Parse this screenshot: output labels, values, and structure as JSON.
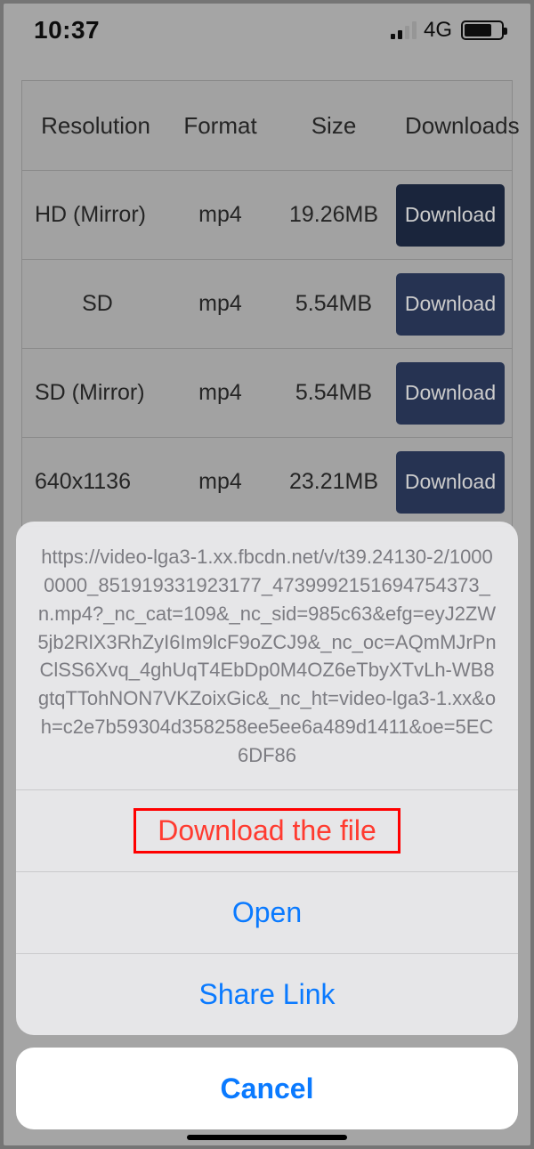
{
  "status": {
    "time": "10:37",
    "network": "4G"
  },
  "table": {
    "headers": {
      "resolution": "Resolution",
      "format": "Format",
      "size": "Size",
      "downloads": "Downloads"
    },
    "download_label": "Download",
    "rows": [
      {
        "resolution": "HD (Mirror)",
        "format": "mp4",
        "size": "19.26MB"
      },
      {
        "resolution": "SD",
        "format": "mp4",
        "size": "5.54MB"
      },
      {
        "resolution": "SD (Mirror)",
        "format": "mp4",
        "size": "5.54MB"
      },
      {
        "resolution": "640x1136",
        "format": "mp4",
        "size": "23.21MB"
      }
    ]
  },
  "sheet": {
    "message": "https://video-lga3-1.xx.fbcdn.net/v/t39.24130-2/10000000_851919331923177_4739992151694754373_n.mp4?_nc_cat=109&_nc_sid=985c63&efg=eyJ2ZW5jb2RlX3RhZyI6Im9lcF9oZCJ9&_nc_oc=AQmMJrPnClSS6Xvq_4ghUqT4EbDp0M4OZ6eTbyXTvLh-WB8gtqTTohNON7VKZoixGic&_nc_ht=video-lga3-1.xx&oh=c2e7b59304d358258ee5ee6a489d1411&oe=5EC6DF86",
    "download": "Download the file",
    "open": "Open",
    "share": "Share Link",
    "cancel": "Cancel"
  }
}
